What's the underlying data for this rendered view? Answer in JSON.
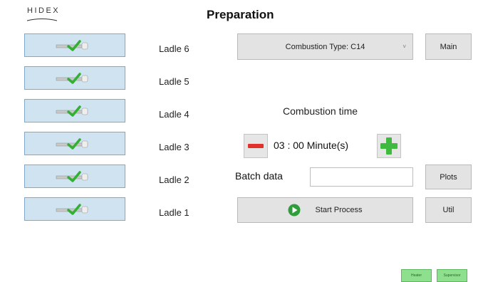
{
  "brand": {
    "logo_text": "HIDEX"
  },
  "header": {
    "title": "Preparation"
  },
  "ladles": [
    {
      "label": "Ladle 6"
    },
    {
      "label": "Ladle 5"
    },
    {
      "label": "Ladle 4"
    },
    {
      "label": "Ladle 3"
    },
    {
      "label": "Ladle 2"
    },
    {
      "label": "Ladle 1"
    }
  ],
  "combustion": {
    "type_selected": "Combustion Type: C14",
    "time_label": "Combustion time",
    "time_value": "03 : 00 Minute(s)"
  },
  "batch": {
    "label": "Batch data",
    "value": ""
  },
  "buttons": {
    "main": "Main",
    "plots": "Plots",
    "start_process": "Start Process",
    "util": "Util"
  },
  "status": {
    "heater": "Heater",
    "supervisor": "Supervisor"
  },
  "colors": {
    "ladle_bg": "#cfe3f1",
    "button_gray": "#e3e3e3",
    "minus_red": "#e0312b",
    "plus_green": "#3fb93f",
    "status_green": "#8ee08e"
  },
  "icons": {
    "ladle_status": "ladle-check-icon",
    "minus": "minus-icon",
    "plus": "plus-icon",
    "start": "play-icon"
  }
}
